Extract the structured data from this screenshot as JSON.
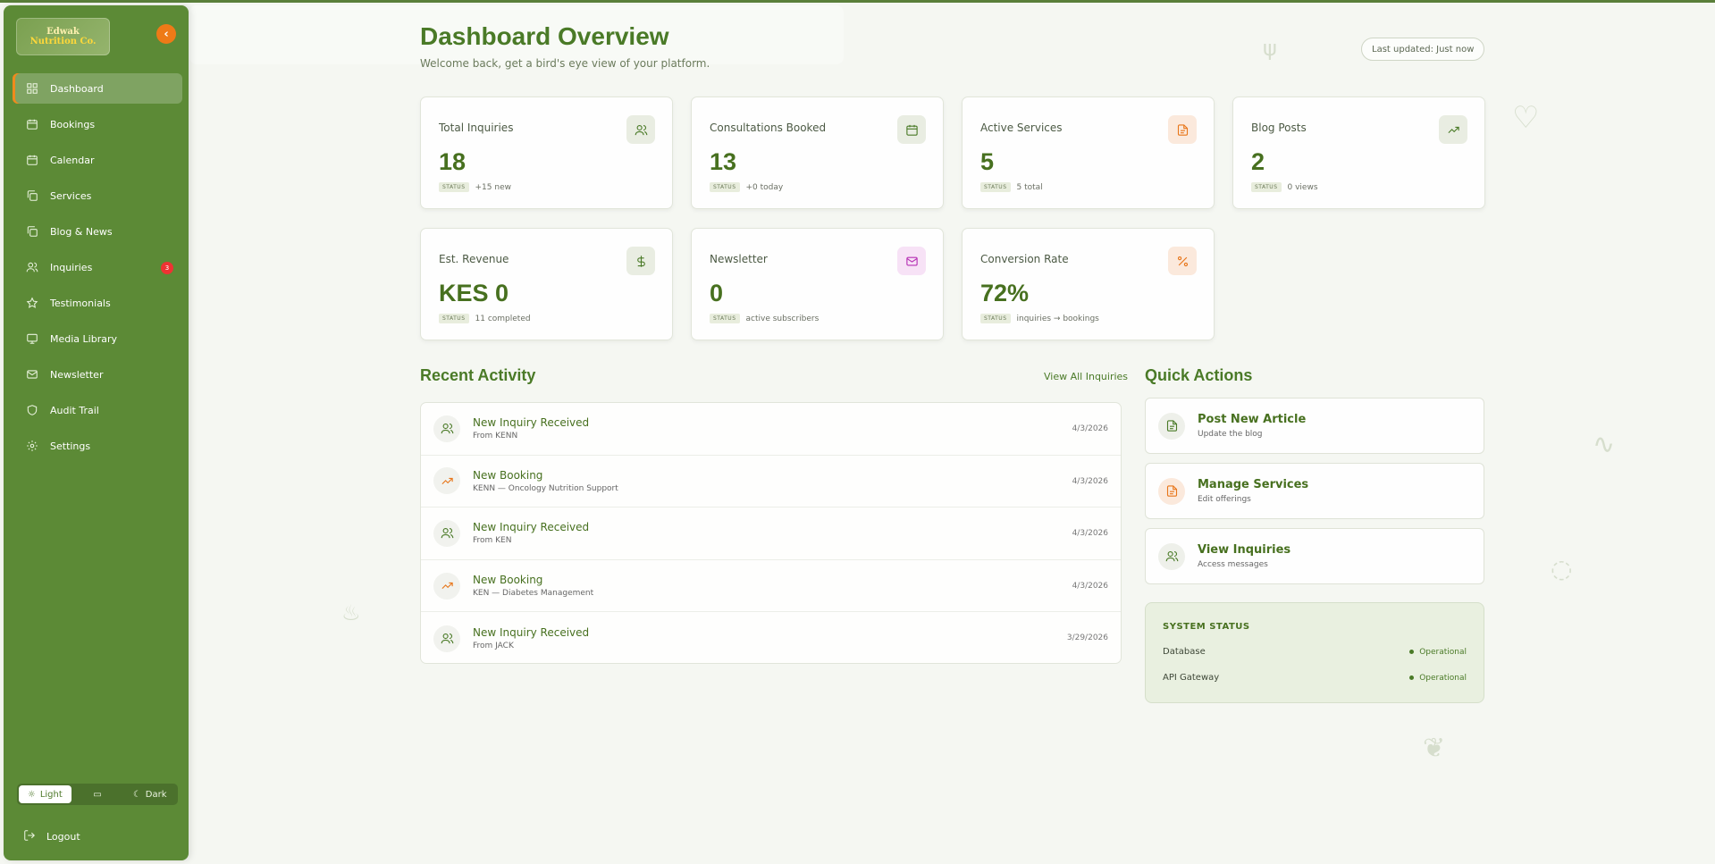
{
  "brand": {
    "line1": "Edwak",
    "line2": "Nutrition Co."
  },
  "sidebar": {
    "items": [
      {
        "label": "Dashboard",
        "icon": "grid-icon",
        "active": true
      },
      {
        "label": "Bookings",
        "icon": "calendar-icon"
      },
      {
        "label": "Calendar",
        "icon": "calendar-icon"
      },
      {
        "label": "Services",
        "icon": "copy-icon"
      },
      {
        "label": "Blog & News",
        "icon": "copy-icon"
      },
      {
        "label": "Inquiries",
        "icon": "users-icon",
        "badge": "3"
      },
      {
        "label": "Testimonials",
        "icon": "star-icon"
      },
      {
        "label": "Media Library",
        "icon": "monitor-icon"
      },
      {
        "label": "Newsletter",
        "icon": "mail-icon"
      },
      {
        "label": "Audit Trail",
        "icon": "shield-icon"
      },
      {
        "label": "Settings",
        "icon": "gear-icon"
      }
    ],
    "theme": {
      "light": "Light",
      "dark": "Dark",
      "selected": "Light"
    },
    "logout": "Logout"
  },
  "header": {
    "title": "Dashboard Overview",
    "subtitle": "Welcome back, get a bird's eye view of your platform.",
    "updated": "Last updated: Just now"
  },
  "stats": [
    {
      "label": "Total Inquiries",
      "value": "18",
      "status": "STATUS",
      "note": "+15 new",
      "icon": "users-icon",
      "color": "#4a7a27",
      "bg": "#e9ede2"
    },
    {
      "label": "Consultations Booked",
      "value": "13",
      "status": "STATUS",
      "note": "+0 today",
      "icon": "calendar-icon",
      "color": "#4a7a27",
      "bg": "#e9ede2"
    },
    {
      "label": "Active Services",
      "value": "5",
      "status": "STATUS",
      "note": "5 total",
      "icon": "document-icon",
      "color": "#e8761a",
      "bg": "#fbe9dc"
    },
    {
      "label": "Blog Posts",
      "value": "2",
      "status": "STATUS",
      "note": "0 views",
      "icon": "trending-icon",
      "color": "#4a7a27",
      "bg": "#e9ede2"
    },
    {
      "label": "Est. Revenue",
      "value": "KES 0",
      "status": "STATUS",
      "note": "11 completed",
      "icon": "dollar-icon",
      "color": "#4a7a27",
      "bg": "#e9ede2"
    },
    {
      "label": "Newsletter",
      "value": "0",
      "status": "STATUS",
      "note": "active subscribers",
      "icon": "mail-icon",
      "color": "#b62fb4",
      "bg": "#f7e2f6"
    },
    {
      "label": "Conversion Rate",
      "value": "72%",
      "status": "STATUS",
      "note": "inquiries → bookings",
      "icon": "percent-icon",
      "color": "#e8761a",
      "bg": "#fbe9dc"
    }
  ],
  "activity": {
    "title": "Recent Activity",
    "view_all": "View All Inquiries",
    "rows": [
      {
        "title": "New Inquiry Received",
        "sub": "From KENN",
        "date": "4/3/2026",
        "kind": "inquiry"
      },
      {
        "title": "New Booking",
        "sub": "KENN — Oncology Nutrition Support",
        "date": "4/3/2026",
        "kind": "booking"
      },
      {
        "title": "New Inquiry Received",
        "sub": "From KEN",
        "date": "4/3/2026",
        "kind": "inquiry"
      },
      {
        "title": "New Booking",
        "sub": "KEN — Diabetes Management",
        "date": "4/3/2026",
        "kind": "booking"
      },
      {
        "title": "New Inquiry Received",
        "sub": "From JACK",
        "date": "3/29/2026",
        "kind": "inquiry"
      }
    ]
  },
  "quick_actions": {
    "title": "Quick Actions",
    "items": [
      {
        "title": "Post New Article",
        "sub": "Update the blog",
        "icon": "document-icon",
        "color": "#4a7a27"
      },
      {
        "title": "Manage Services",
        "sub": "Edit offerings",
        "icon": "document-icon",
        "color": "#e8761a"
      },
      {
        "title": "View Inquiries",
        "sub": "Access messages",
        "icon": "users-icon",
        "color": "#4a7a27"
      }
    ]
  },
  "system_status": {
    "title": "SYSTEM STATUS",
    "rows": [
      {
        "name": "Database",
        "state": "Operational"
      },
      {
        "name": "API Gateway",
        "state": "Operational"
      }
    ]
  }
}
